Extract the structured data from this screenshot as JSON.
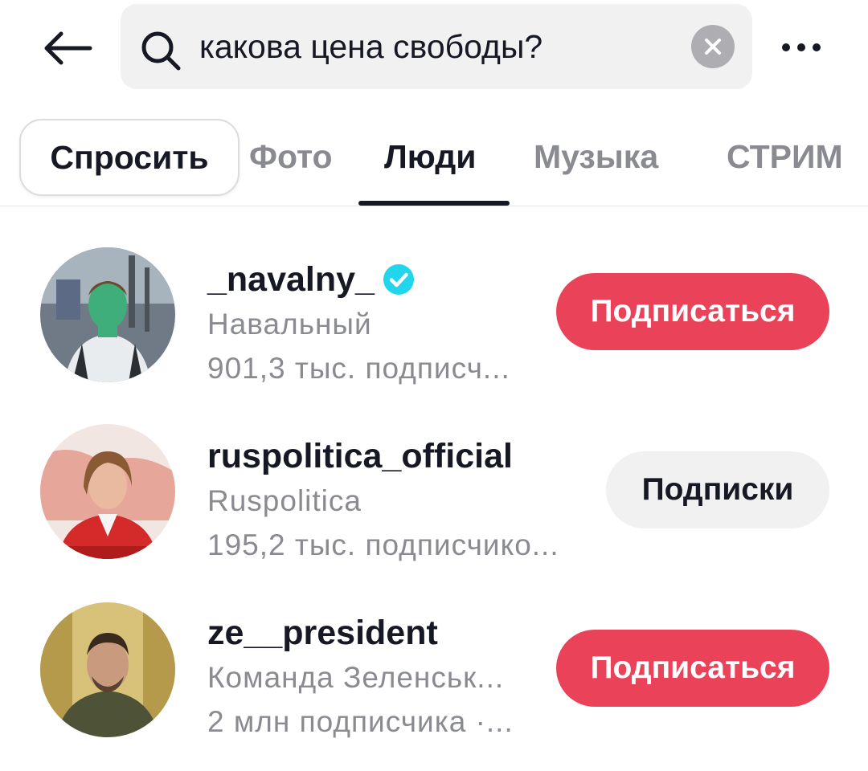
{
  "header": {
    "back_icon": "arrow-left-icon",
    "search_icon": "search-icon",
    "search_query": "какова цена свободы?",
    "clear_icon": "clear-x-icon",
    "more_icon": "more-horizontal-icon"
  },
  "tabs": [
    {
      "label": "Спросить",
      "style": "pill"
    },
    {
      "label": "Фото",
      "active": false
    },
    {
      "label": "Люди",
      "active": true
    },
    {
      "label": "Музыка",
      "active": false
    },
    {
      "label": "СТРИМ",
      "active": false
    }
  ],
  "results": [
    {
      "username": "_navalny_",
      "verified": true,
      "display_name": "Навальный",
      "followers": "901,3 тыс. подписч...",
      "button_label": "Подписаться",
      "button_state": "follow"
    },
    {
      "username": "ruspolitica_official",
      "verified": false,
      "display_name": "Ruspolitica",
      "followers": "195,2 тыс. подписчико...",
      "button_label": "Подписки",
      "button_state": "following"
    },
    {
      "username": "ze__president",
      "verified": false,
      "display_name": "Команда Зеленськ...",
      "followers": "2 млн подписчика ·...",
      "button_label": "Подписаться",
      "button_state": "follow"
    }
  ],
  "colors": {
    "accent": "#ea4359",
    "verified": "#20d5ec",
    "secondary_text": "#8a8b91",
    "chip_bg": "#f1f1f2"
  }
}
